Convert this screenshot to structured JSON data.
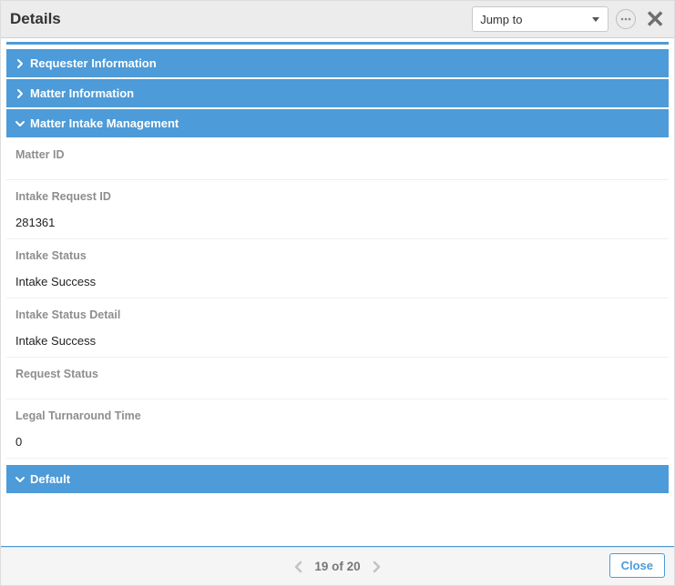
{
  "header": {
    "title": "Details",
    "jump_to": "Jump to"
  },
  "sections": {
    "requester": {
      "title": "Requester Information"
    },
    "matter": {
      "title": "Matter Information"
    },
    "intake_mgmt": {
      "title": "Matter Intake Management"
    },
    "default": {
      "title": "Default"
    }
  },
  "fields": {
    "matter_id": {
      "label": "Matter ID",
      "value": ""
    },
    "intake_request_id": {
      "label": "Intake Request ID",
      "value": "281361"
    },
    "intake_status": {
      "label": "Intake Status",
      "value": "Intake Success"
    },
    "intake_status_detail": {
      "label": "Intake Status Detail",
      "value": "Intake Success"
    },
    "request_status": {
      "label": "Request Status",
      "value": ""
    },
    "legal_turnaround_time": {
      "label": "Legal Turnaround Time",
      "value": "0"
    }
  },
  "footer": {
    "page_text": "19 of 20",
    "close_label": "Close"
  }
}
